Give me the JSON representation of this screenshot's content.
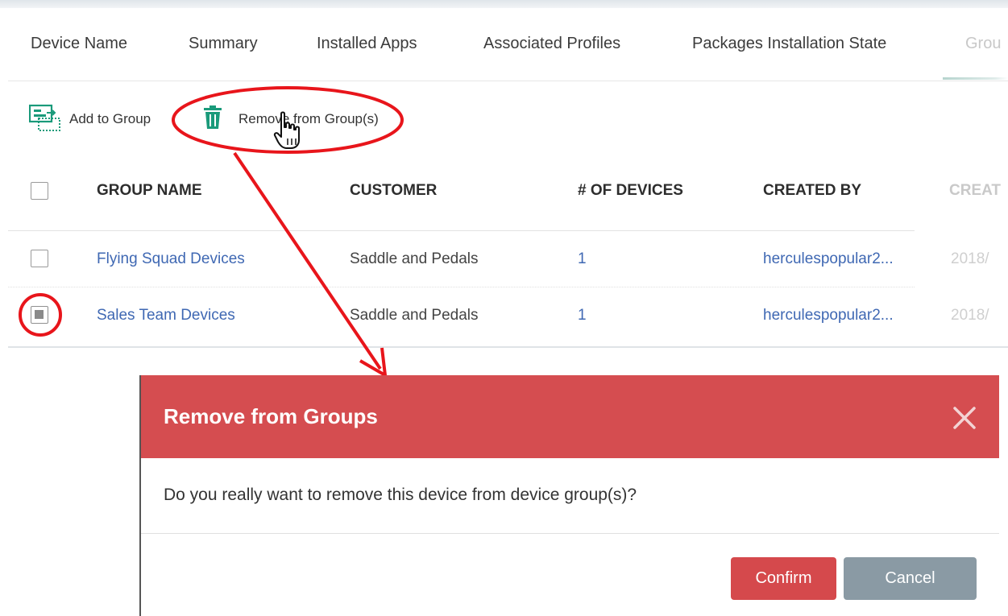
{
  "tabs": [
    {
      "label": "Device Name"
    },
    {
      "label": "Summary"
    },
    {
      "label": "Installed Apps"
    },
    {
      "label": "Associated Profiles"
    },
    {
      "label": "Packages Installation State"
    },
    {
      "label": "Grou"
    }
  ],
  "toolbar": {
    "add_label": "Add to Group",
    "add_icon": "add-to-group-icon",
    "remove_label": "Remove from Group(s)",
    "remove_icon": "trash-icon",
    "accent": "#1a9a7a"
  },
  "table": {
    "headers": [
      "GROUP NAME",
      "CUSTOMER",
      "# OF DEVICES",
      "CREATED BY",
      "CREAT"
    ],
    "rows": [
      {
        "checked": false,
        "group": "Flying Squad Devices",
        "customer": "Saddle and Pedals",
        "devices": "1",
        "created_by": "herculespopular2...",
        "created": "2018/"
      },
      {
        "checked": true,
        "group": "Sales Team Devices",
        "customer": "Saddle and Pedals",
        "devices": "1",
        "created_by": "herculespopular2...",
        "created": "2018/"
      }
    ]
  },
  "dialog": {
    "title": "Remove from Groups",
    "message": "Do you really want to remove this device from device group(s)?",
    "confirm_label": "Confirm",
    "cancel_label": "Cancel",
    "header_color": "#d54d50",
    "confirm_color": "#d5494c",
    "cancel_color": "#8a9aa4"
  },
  "annotation_color": "#e8151b"
}
